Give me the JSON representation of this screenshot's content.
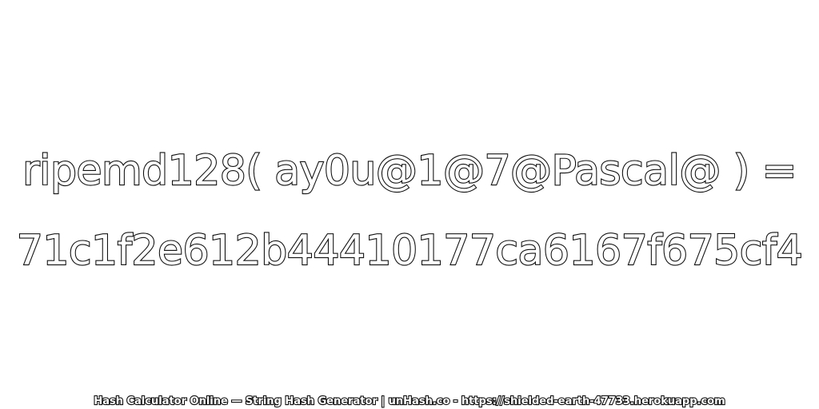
{
  "expression": "ripemd128( ay0u@1@7@Pascal@ ) =",
  "hash": "71c1f2e612b44410177ca6167f675cf4",
  "footer": "Hash Calculator Online — String Hash Generator | unHash.co - https://shielded-earth-47733.herokuapp.com",
  "colors": {
    "background": "#ffffff",
    "text_fill": "#ffffff",
    "text_outline": "#111111"
  }
}
